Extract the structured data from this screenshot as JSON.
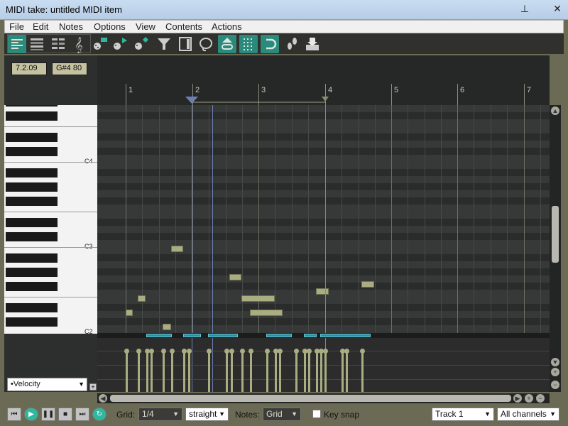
{
  "window": {
    "title": "MIDI take: untitled MIDI item",
    "pin_glyph": "⊥",
    "close_glyph": "✕"
  },
  "menu": [
    "File",
    "Edit",
    "Notes",
    "Options",
    "View",
    "Contents",
    "Actions"
  ],
  "toolbar": {
    "icons": [
      "piano-roll-icon",
      "named-notes-icon",
      "drum-grid-icon",
      "treble-clef-icon",
      "insert-note-icon",
      "step-input-icon",
      "color-palette-icon",
      "filter-icon",
      "event-list-icon",
      "lasso-icon",
      "link-icon",
      "grid-snap-icon",
      "loop-icon",
      "footsteps-icon",
      "save-down-icon"
    ]
  },
  "status": {
    "position": "7.2.09",
    "note": "G#4  80"
  },
  "ruler": {
    "measures": [
      "1",
      "2",
      "3",
      "4",
      "5",
      "6",
      "7"
    ]
  },
  "keyboard": {
    "labels": [
      "C4",
      "C3",
      "C2"
    ]
  },
  "velocity_lane": {
    "selected": "•Velocity",
    "add_label": "+"
  },
  "bottom": {
    "grid_label": "Grid:",
    "grid_value": "1/4",
    "swing_value": "straight",
    "notes_label": "Notes:",
    "notes_value": "Grid",
    "key_snap_label": "Key snap",
    "track_value": "Track 1",
    "channel_value": "All channels"
  },
  "colors": {
    "accent": "#2fb8a0",
    "note": "#a9ad81",
    "background": "#6b6b55"
  }
}
